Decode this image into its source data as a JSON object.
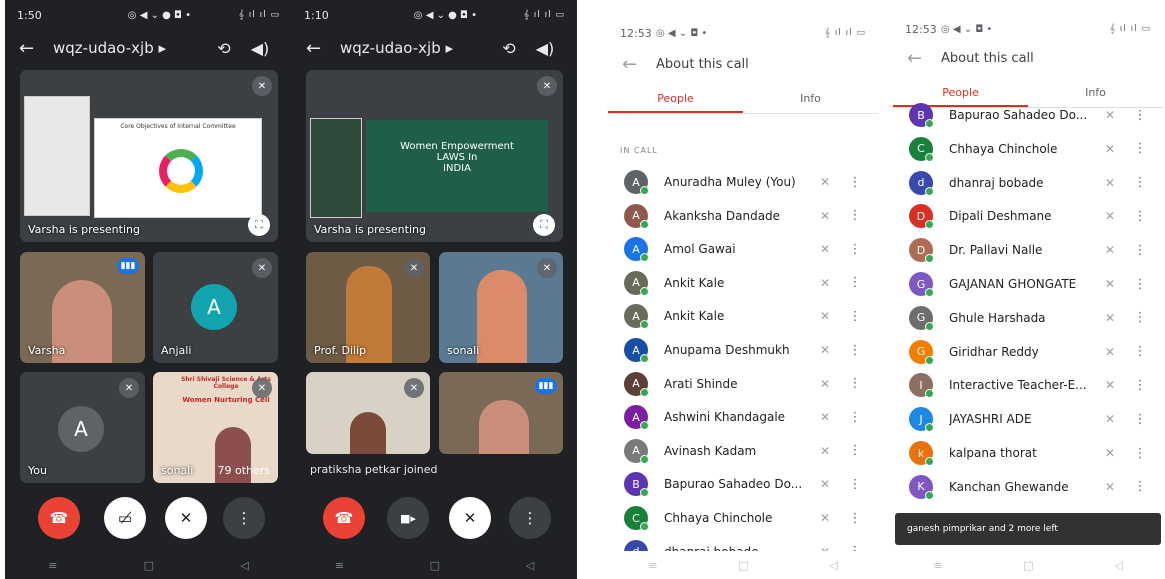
{
  "p1": {
    "status": {
      "time": "1:50",
      "left_icons": "◎ ◀ ⌄ ● ◘ •",
      "right": "𝄞 ıl ıl ▭"
    },
    "header": {
      "title": "wqz-udao-xjb ▸"
    },
    "present": {
      "label": "Varsha is presenting",
      "slide_title": "Core Objectives of Internal Committee"
    },
    "tiles": {
      "t1": "Varsha",
      "t2": "Anjali",
      "t2_initial": "A",
      "t3": "You",
      "t3_initial": "A",
      "t4": "sonali",
      "t4_others": "79 others",
      "t4_banner1": "Shri Shivaji Science & Arts College",
      "t4_banner2": "Women Nurturing Cell"
    }
  },
  "p2": {
    "status": {
      "time": "1:10",
      "left_icons": "◎ ◀ ⌄ ● ◘ •",
      "right": "𝄞 ıl ıl ▭"
    },
    "header": {
      "title": "wqz-udao-xjb ▸"
    },
    "present": {
      "label": "Varsha is presenting",
      "slide_text1": "Women Empowerment",
      "slide_text2": "LAWS In",
      "slide_text3": "INDIA"
    },
    "tiles": {
      "t1": "Prof. Dilip",
      "t2": "sonali",
      "t3": "pratiksha petkar joined"
    }
  },
  "p3": {
    "status": {
      "time": "12:53",
      "left_icons": "◎ ◀ ⌄ ◘ •",
      "right": "𝄞 ıl ıl ▭"
    },
    "header": {
      "title": "About this call"
    },
    "tabs": {
      "people": "People",
      "info": "Info"
    },
    "section": "IN CALL",
    "rows": [
      {
        "name": "Anuradha Muley (You)",
        "init": "A",
        "color": "#5f6368"
      },
      {
        "name": "Akanksha Dandade",
        "init": "A",
        "color": "#8e5a4b"
      },
      {
        "name": "Amol Gawai",
        "init": "A",
        "color": "#1a73e8"
      },
      {
        "name": "Ankit Kale",
        "init": "A",
        "color": "#6b6b5b"
      },
      {
        "name": "Ankit Kale",
        "init": "A",
        "color": "#6b6b5b"
      },
      {
        "name": "Anupama Deshmukh",
        "init": "A",
        "color": "#174ea6"
      },
      {
        "name": "Arati Shinde",
        "init": "A",
        "color": "#5d4037"
      },
      {
        "name": "Ashwini Khandagale",
        "init": "A",
        "color": "#7b1fa2"
      },
      {
        "name": "Avinash Kadam",
        "init": "A",
        "color": "#7a7a7a"
      },
      {
        "name": "Bapurao Sahadeo Do...",
        "init": "B",
        "color": "#5e35b1"
      },
      {
        "name": "Chhaya Chinchole",
        "init": "C",
        "color": "#188038"
      },
      {
        "name": "dhanraj bobade",
        "init": "d",
        "color": "#3949ab"
      }
    ]
  },
  "p4": {
    "status": {
      "time": "12:53",
      "left_icons": "◎ ◀ ⌄ ◘ •",
      "right": "𝄞 ıl ıl ▭"
    },
    "header": {
      "title": "About this call"
    },
    "tabs": {
      "people": "People",
      "info": "Info"
    },
    "rows": [
      {
        "name": "Bapurao Sahadeo Do...",
        "init": "B",
        "color": "#5e35b1"
      },
      {
        "name": "Chhaya Chinchole",
        "init": "C",
        "color": "#188038"
      },
      {
        "name": "dhanraj bobade",
        "init": "d",
        "color": "#3949ab"
      },
      {
        "name": "Dipali Deshmane",
        "init": "D",
        "color": "#d93025"
      },
      {
        "name": "Dr. Pallavi Nalle",
        "init": "D",
        "color": "#b06b55"
      },
      {
        "name": "GAJANAN GHONGATE",
        "init": "G",
        "color": "#7e57c2"
      },
      {
        "name": "Ghule Harshada",
        "init": "G",
        "color": "#6d6d6d"
      },
      {
        "name": "Giridhar Reddy",
        "init": "G",
        "color": "#f57c00"
      },
      {
        "name": "Interactive Teacher-E...",
        "init": "I",
        "color": "#8d6e63"
      },
      {
        "name": "JAYASHRI ADE",
        "init": "J",
        "color": "#1e88e5"
      },
      {
        "name": "kalpana thorat",
        "init": "k",
        "color": "#e8710a"
      },
      {
        "name": "Kanchan Ghewande",
        "init": "K",
        "color": "#7e57c2"
      }
    ],
    "toast": "ganesh pimprikar and 2 more left"
  },
  "icons": {
    "back": "←",
    "flip": "⟲",
    "speaker": "◀)",
    "muted": "✕",
    "more": "⋮",
    "end": "☎",
    "camoff": "▭̸",
    "cam": "■▸",
    "mic_off": "✕",
    "expand": "⛶",
    "nav_menu": "≡",
    "nav_home": "□",
    "nav_back": "◁"
  },
  "colors": {
    "dark_bg": "#202124",
    "tile_bg": "#3c4043",
    "end_red": "#ea4335",
    "tab_red": "#d93025",
    "toast_bg": "#323232"
  }
}
